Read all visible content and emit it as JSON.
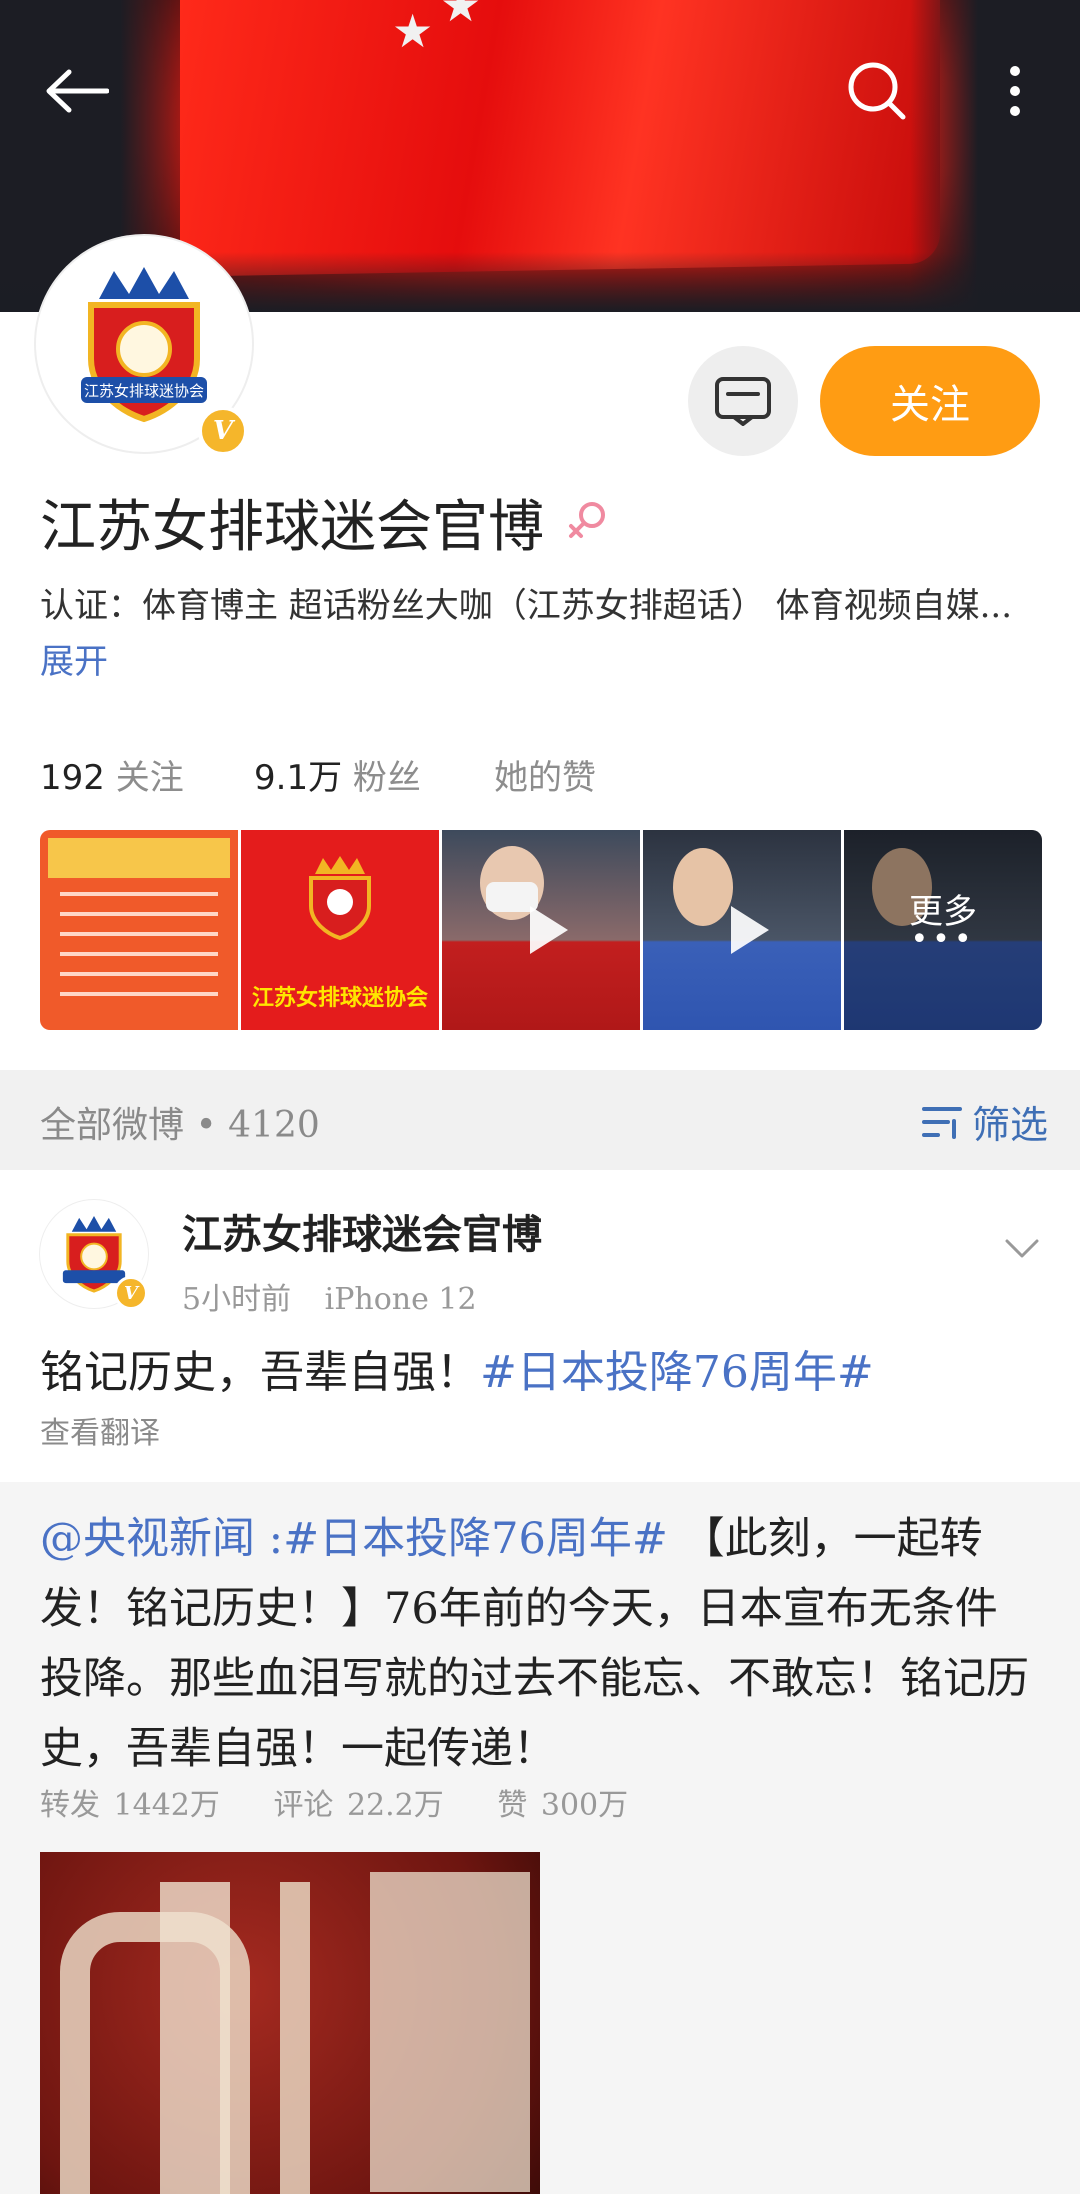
{
  "profile": {
    "name": "江苏女排球迷会官博",
    "verification_text": "认证：体育博主 超话粉丝大咖（江苏女排超话） 体育视频自媒...",
    "expand_label": "展开",
    "follow_label": "关注",
    "stats": {
      "following_count": "192",
      "following_label": "关注",
      "fans_count": "9.1万",
      "fans_label": "粉丝",
      "likes_label": "她的赞"
    },
    "more_label": "更多"
  },
  "thumbnails": [
    {
      "type": "image",
      "name": "schedule-poster"
    },
    {
      "type": "image",
      "name": "club-logo-poster",
      "caption": "江苏女排球迷协会"
    },
    {
      "type": "video",
      "name": "coach-interview"
    },
    {
      "type": "video",
      "name": "player-interview-1"
    },
    {
      "type": "video",
      "name": "player-interview-2"
    }
  ],
  "feed": {
    "all_posts_label": "全部微博",
    "post_count": "4120",
    "filter_label": "筛选"
  },
  "post": {
    "author": "江苏女排球迷会官博",
    "time": "5小时前",
    "device": "iPhone 12",
    "text_before": "铭记历史，吾辈自强！",
    "hashtag": "#日本投降76周年#",
    "translate_label": "查看翻译",
    "repost": {
      "mention": "@央视新闻",
      "colon": " :",
      "hashtag": "#日本投降76周年#",
      "body": " 【此刻，一起转发！铭记历史！】76年前的今天，日本宣布无条件投降。那些血泪写就的过去不能忘、不敢忘！铭记历史，吾辈自强！一起传递！",
      "reposts": "转发 1442万",
      "comments": "评论 22.2万",
      "likes": "赞 300万"
    }
  },
  "colors": {
    "accent_orange": "#ff9c13",
    "link_blue": "#4a72c5",
    "verify_gold": "#f5b62b"
  }
}
